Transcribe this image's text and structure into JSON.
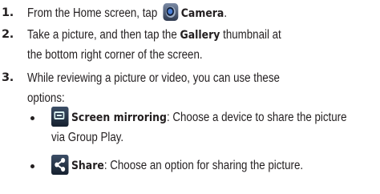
{
  "steps": [
    {
      "number": "1.",
      "pre": "From the Home screen, tap ",
      "bold": "Camera",
      "post": "."
    },
    {
      "number": "2.",
      "line1_pre": "Take a picture, and then tap the ",
      "line1_bold": "Gallery",
      "line1_post": " thumbnail at",
      "line2": "the bottom right corner of the screen."
    },
    {
      "number": "3.",
      "line1": "While reviewing a picture or video, you can use these",
      "line2": "options:"
    }
  ],
  "options": [
    {
      "icon": "screen-mirroring-icon",
      "bold": "Screen mirroring",
      "line1_post": ": Choose a device to share the picture",
      "line2": "via Group Play."
    },
    {
      "icon": "share-icon",
      "bold": "Share",
      "line1_post": ": Choose an option for sharing the picture."
    }
  ]
}
